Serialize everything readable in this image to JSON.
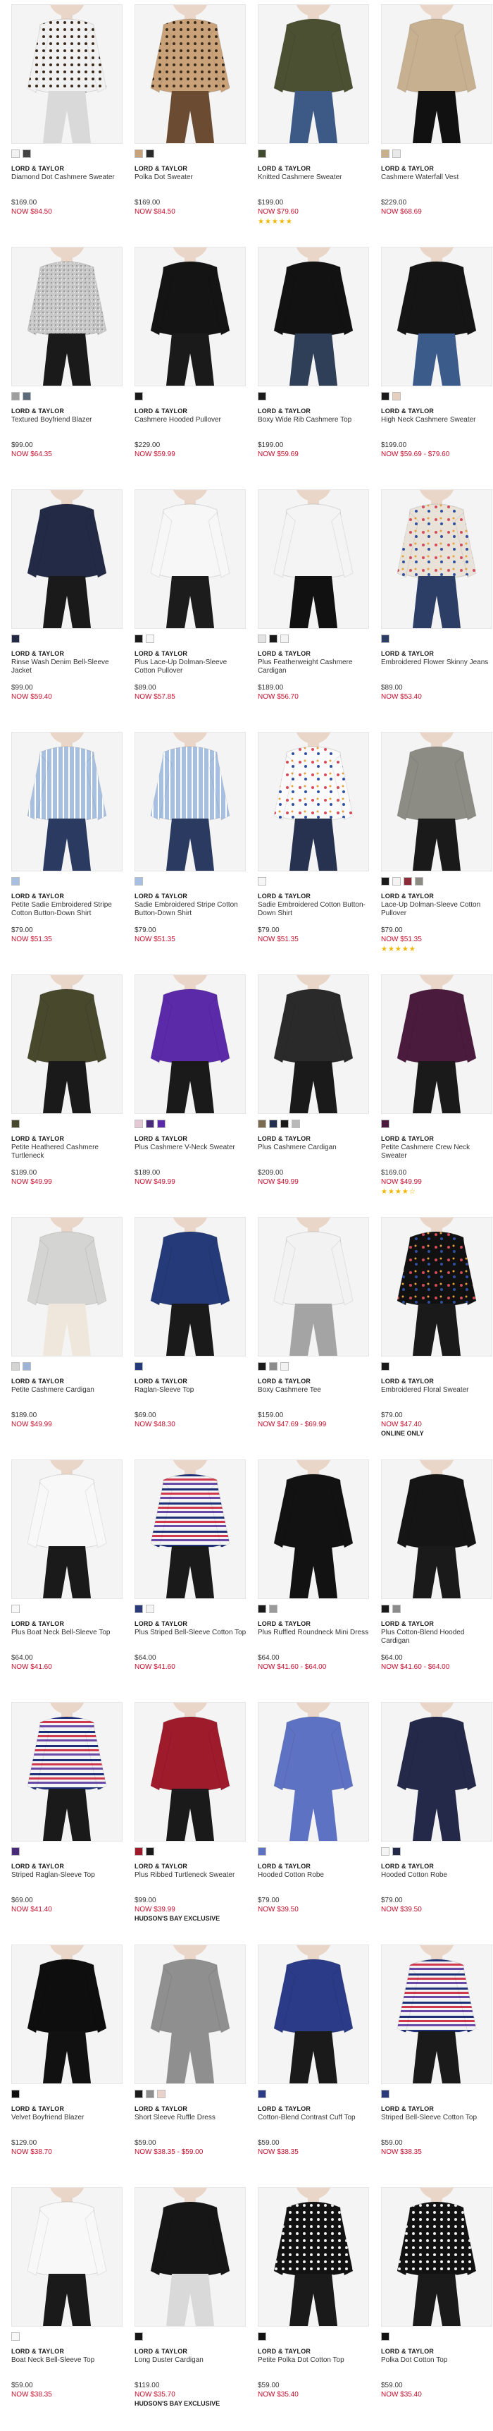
{
  "products": [
    {
      "brand": "LORD & TAYLOR",
      "name": "Diamond Dot Cashmere Sweater",
      "price": "$169.00",
      "now": "NOW  $84.50",
      "color": "#f1f1f1",
      "bottom": "#d9d9d9",
      "pattern": "dots",
      "swatches": [
        "#f2f2f2",
        "#444444"
      ]
    },
    {
      "brand": "LORD & TAYLOR",
      "name": "Polka Dot Sweater",
      "price": "$169.00",
      "now": "NOW  $84.50",
      "color": "#c9a27a",
      "bottom": "#6b4c32",
      "pattern": "dots",
      "swatches": [
        "#c9a27a",
        "#2b2b2b"
      ]
    },
    {
      "brand": "LORD & TAYLOR",
      "name": "Knitted Cashmere Sweater",
      "price": "$199.00",
      "now": "NOW  $79.60",
      "stars": "★★★★★",
      "color": "#4b5032",
      "bottom": "#3d5a86",
      "swatches": [
        "#3f4a2f"
      ]
    },
    {
      "brand": "LORD & TAYLOR",
      "name": "Cashmere Waterfall Vest",
      "price": "$229.00",
      "now": "NOW  $68.69",
      "color": "#c7b090",
      "bottom": "#111111",
      "swatches": [
        "#c9b08a",
        "#e9e9e9"
      ]
    },
    {
      "brand": "LORD & TAYLOR",
      "name": "Textured Boyfriend Blazer",
      "price": "$99.00",
      "now": "NOW  $64.35",
      "color": "#c8c8c8",
      "bottom": "#1a1a1a",
      "pattern": "tweed",
      "swatches": [
        "#9e9e9e",
        "#5a6a7a"
      ]
    },
    {
      "brand": "LORD & TAYLOR",
      "name": "Cashmere Hooded Pullover",
      "price": "$229.00",
      "now": "NOW  $59.99",
      "color": "#141414",
      "bottom": "#1a1a1a",
      "swatches": [
        "#1a1a1a"
      ]
    },
    {
      "brand": "LORD & TAYLOR",
      "name": "Boxy Wide Rib Cashmere Top",
      "price": "$199.00",
      "now": "NOW  $59.69",
      "color": "#121212",
      "bottom": "#2f3f58",
      "swatches": [
        "#1a1a1a"
      ]
    },
    {
      "brand": "LORD & TAYLOR",
      "name": "High Neck Cashmere Sweater",
      "price": "$199.00",
      "now": "NOW  $59.69 - $79.60",
      "color": "#151515",
      "bottom": "#3b5c8a",
      "swatches": [
        "#1a1a1a",
        "#e7cfc0"
      ]
    },
    {
      "brand": "LORD & TAYLOR",
      "name": "Rinse Wash Denim Bell-Sleeve Jacket",
      "price": "$99.00",
      "now": "NOW  $59.40",
      "color": "#232a45",
      "bottom": "#1a1a1a",
      "swatches": [
        "#232a45"
      ]
    },
    {
      "brand": "LORD & TAYLOR",
      "name": "Plus Lace-Up Dolman-Sleeve Cotton Pullover",
      "price": "$89.00",
      "now": "NOW  $57.85",
      "color": "#f7f7f7",
      "bottom": "#1c1c1c",
      "swatches": [
        "#1a1a1a",
        "#f7f7f7"
      ]
    },
    {
      "brand": "LORD & TAYLOR",
      "name": "Plus Featherweight Cashmere Cardigan",
      "price": "$189.00",
      "now": "NOW  $56.70",
      "color": "#f4f4f4",
      "bottom": "#111111",
      "swatches": [
        "#e3e3e3",
        "#1a1a1a",
        "#f4f4f4"
      ]
    },
    {
      "brand": "LORD & TAYLOR",
      "name": "Embroidered Flower Skinny Jeans",
      "price": "$89.00",
      "now": "NOW  $53.40",
      "color": "#e9e2d8",
      "bottom": "#2d3e66",
      "pattern": "flowers",
      "swatches": [
        "#2d3e66"
      ]
    },
    {
      "brand": "LORD & TAYLOR",
      "name": "Petite Sadie Embroidered Stripe Cotton Button-Down Shirt",
      "price": "$79.00",
      "now": "NOW  $51.35",
      "color": "#a7c0e2",
      "bottom": "#2a3a60",
      "pattern": "stripes",
      "swatches": [
        "#a7c0e2"
      ]
    },
    {
      "brand": "LORD & TAYLOR",
      "name": "Sadie Embroidered Stripe Cotton Button-Down Shirt",
      "price": "$79.00",
      "now": "NOW  $51.35",
      "color": "#a7c0e2",
      "bottom": "#2a3a60",
      "pattern": "stripes",
      "swatches": [
        "#a7c0e2"
      ]
    },
    {
      "brand": "LORD & TAYLOR",
      "name": "Sadie Embroidered Cotton Button-Down Shirt",
      "price": "$79.00",
      "now": "NOW  $51.35",
      "color": "#fafafa",
      "bottom": "#26324f",
      "pattern": "flowers",
      "swatches": [
        "#f6f6f6"
      ]
    },
    {
      "brand": "LORD & TAYLOR",
      "name": "Lace-Up Dolman-Sleeve Cotton Pullover",
      "price": "$79.00",
      "now": "NOW  $51.35",
      "stars": "★★★★★",
      "color": "#8c8c84",
      "bottom": "#1a1a1a",
      "swatches": [
        "#1a1a1a",
        "#f4f4f4",
        "#8b2c3b",
        "#8c8c84"
      ]
    },
    {
      "brand": "LORD & TAYLOR",
      "name": "Petite Heathered Cashmere Turtleneck",
      "price": "$189.00",
      "now": "NOW  $49.99",
      "color": "#47482c",
      "bottom": "#1a1a1a",
      "swatches": [
        "#47482c"
      ]
    },
    {
      "brand": "LORD & TAYLOR",
      "name": "Plus Cashmere V-Neck Sweater",
      "price": "$189.00",
      "now": "NOW  $49.99",
      "color": "#5b2aa8",
      "bottom": "#1a1a1a",
      "swatches": [
        "#e4c9d4",
        "#4a2a7a",
        "#5b2aa8"
      ]
    },
    {
      "brand": "LORD & TAYLOR",
      "name": "Plus Cashmere Cardigan",
      "price": "$209.00",
      "now": "NOW  $49.99",
      "color": "#2a2a2a",
      "bottom": "#1a1a1a",
      "swatches": [
        "#7a6a50",
        "#23304f",
        "#1a1a1a",
        "#b9b9b9"
      ]
    },
    {
      "brand": "LORD & TAYLOR",
      "name": "Petite Cashmere Crew Neck Sweater",
      "price": "$169.00",
      "now": "NOW  $49.99",
      "stars": "★★★★☆",
      "color": "#4a1b3d",
      "bottom": "#1a1a1a",
      "swatches": [
        "#4a1b3d"
      ]
    },
    {
      "brand": "LORD & TAYLOR",
      "name": "Petite Cashmere Cardigan",
      "price": "$189.00",
      "now": "NOW  $49.99",
      "color": "#d4d4d2",
      "bottom": "#efe7dc",
      "swatches": [
        "#d4d4d2",
        "#9ab3d6"
      ]
    },
    {
      "brand": "LORD & TAYLOR",
      "name": "Raglan-Sleeve Top",
      "price": "$69.00",
      "now": "NOW  $48.30",
      "color": "#253a78",
      "bottom": "#1a1a1a",
      "swatches": [
        "#253a78"
      ]
    },
    {
      "brand": "LORD & TAYLOR",
      "name": "Boxy Cashmere Tee",
      "price": "$159.00",
      "now": "NOW  $47.69 - $69.99",
      "color": "#f2f2f2",
      "bottom": "#a4a4a4",
      "swatches": [
        "#1a1a1a",
        "#8c8c8c",
        "#f2f2f2"
      ]
    },
    {
      "brand": "LORD & TAYLOR",
      "name": "Embroidered Floral Sweater",
      "price": "$79.00",
      "now": "NOW  $47.40",
      "note": "ONLINE ONLY",
      "color": "#111111",
      "bottom": "#1a1a1a",
      "pattern": "flowers",
      "swatches": [
        "#1a1a1a"
      ]
    },
    {
      "brand": "LORD & TAYLOR",
      "name": "Plus Boat Neck Bell-Sleeve Top",
      "price": "$64.00",
      "now": "NOW  $41.60",
      "color": "#f8f8f8",
      "bottom": "#1a1a1a",
      "swatches": [
        "#f8f8f8"
      ]
    },
    {
      "brand": "LORD & TAYLOR",
      "name": "Plus Striped Bell-Sleeve Cotton Top",
      "price": "$64.00",
      "now": "NOW  $41.60",
      "color": "#f4f4f4",
      "bottom": "#1a1a1a",
      "pattern": "stripes-multi",
      "swatches": [
        "#2a3a7a",
        "#f4f4f4"
      ]
    },
    {
      "brand": "LORD & TAYLOR",
      "name": "Plus Ruffled Roundneck Mini Dress",
      "price": "$64.00",
      "now": "NOW  $41.60 - $64.00",
      "color": "#121212",
      "bottom": "#121212",
      "swatches": [
        "#1a1a1a",
        "#9a9a9a"
      ]
    },
    {
      "brand": "LORD & TAYLOR",
      "name": "Plus Cotton-Blend Hooded Cardigan",
      "price": "$64.00",
      "now": "NOW  $41.60 - $64.00",
      "color": "#151515",
      "bottom": "#1a1a1a",
      "swatches": [
        "#1a1a1a",
        "#8c8c8c"
      ]
    },
    {
      "brand": "LORD & TAYLOR",
      "name": "Striped Raglan-Sleeve Top",
      "price": "$69.00",
      "now": "NOW  $41.40",
      "color": "#f4f4f4",
      "bottom": "#1a1a1a",
      "pattern": "stripes-multi",
      "swatches": [
        "#4a2a7a"
      ]
    },
    {
      "brand": "LORD & TAYLOR",
      "name": "Plus Ribbed Turtleneck Sweater",
      "price": "$99.00",
      "now": "NOW  $39.99",
      "note": "HUDSON'S BAY EXCLUSIVE",
      "color": "#9e1b2c",
      "bottom": "#1a1a1a",
      "swatches": [
        "#9e1b2c",
        "#1a1a1a"
      ]
    },
    {
      "brand": "LORD & TAYLOR",
      "name": "Hooded Cotton Robe",
      "price": "$79.00",
      "now": "NOW  $39.50",
      "color": "#5e72c4",
      "bottom": "#5e72c4",
      "swatches": [
        "#5e72c4"
      ]
    },
    {
      "brand": "LORD & TAYLOR",
      "name": "Hooded Cotton Robe",
      "price": "$79.00",
      "now": "NOW  $39.50",
      "color": "#24294a",
      "bottom": "#24294a",
      "swatches": [
        "#f4f4f4",
        "#24294a"
      ]
    },
    {
      "brand": "LORD & TAYLOR",
      "name": "Velvet Boyfriend Blazer",
      "price": "$129.00",
      "now": "NOW  $38.70",
      "color": "#0e0e0e",
      "bottom": "#111111",
      "swatches": [
        "#0e0e0e"
      ]
    },
    {
      "brand": "LORD & TAYLOR",
      "name": "Short Sleeve Ruffle Dress",
      "price": "$59.00",
      "now": "NOW  $38.35 - $59.00",
      "color": "#8f8f8f",
      "bottom": "#8f8f8f",
      "swatches": [
        "#1a1a1a",
        "#8f8f8f",
        "#e8d2c9"
      ]
    },
    {
      "brand": "LORD & TAYLOR",
      "name": "Cotton-Blend Contrast Cuff Top",
      "price": "$59.00",
      "now": "NOW  $38.35",
      "color": "#2b3b88",
      "bottom": "#1a1a1a",
      "swatches": [
        "#2b3b88"
      ]
    },
    {
      "brand": "LORD & TAYLOR",
      "name": "Striped Bell-Sleeve Cotton Top",
      "price": "$59.00",
      "now": "NOW  $38.35",
      "color": "#f4f4f4",
      "bottom": "#1a1a1a",
      "pattern": "stripes-multi",
      "swatches": [
        "#2a3a7a"
      ]
    },
    {
      "brand": "LORD & TAYLOR",
      "name": "Boat Neck Bell-Sleeve Top",
      "price": "$59.00",
      "now": "NOW  $38.35",
      "color": "#f8f8f8",
      "bottom": "#1a1a1a",
      "swatches": [
        "#f8f8f8"
      ]
    },
    {
      "brand": "LORD & TAYLOR",
      "name": "Long Duster Cardigan",
      "price": "$119.00",
      "now": "NOW  $35.70",
      "note": "HUDSON'S BAY EXCLUSIVE",
      "color": "#161616",
      "bottom": "#d9d9d9",
      "swatches": [
        "#161616"
      ]
    },
    {
      "brand": "LORD & TAYLOR",
      "name": "Petite Polka Dot Cotton Top",
      "price": "$59.00",
      "now": "NOW  $35.40",
      "color": "#121212",
      "bottom": "#1a1a1a",
      "pattern": "dots-light",
      "swatches": [
        "#121212"
      ]
    },
    {
      "brand": "LORD & TAYLOR",
      "name": "Polka Dot Cotton Top",
      "price": "$59.00",
      "now": "NOW  $35.40",
      "color": "#121212",
      "bottom": "#1a1a1a",
      "pattern": "dots-light",
      "swatches": [
        "#121212"
      ]
    }
  ]
}
